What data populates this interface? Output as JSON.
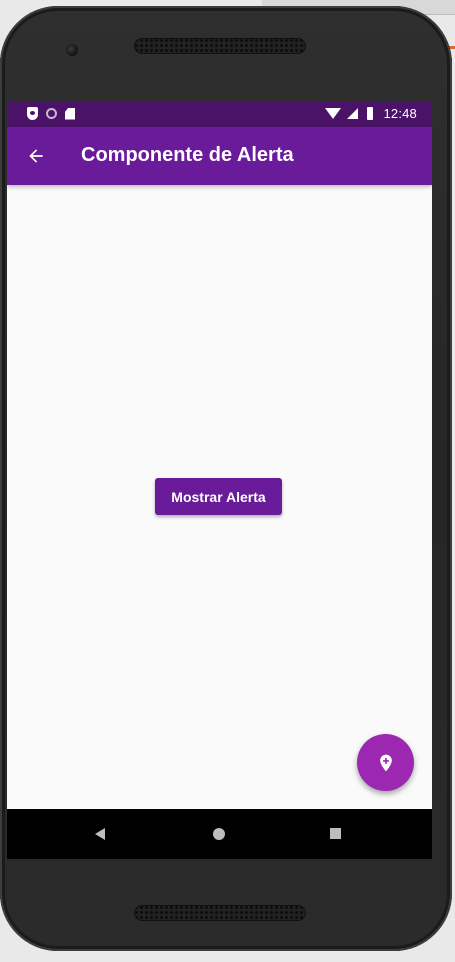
{
  "status_bar": {
    "time": "12:48",
    "left_icons": [
      "shield-icon",
      "circle-icon",
      "sd-card-icon"
    ],
    "right_icons": [
      "wifi-icon",
      "signal-icon",
      "battery-icon"
    ],
    "color": "#4a1367"
  },
  "app_bar": {
    "title": "Componente de Alerta",
    "back_icon": "arrow-left-icon",
    "color": "#6a1b9a"
  },
  "main": {
    "show_alert_label": "Mostrar Alerta",
    "button_color": "#6a1b9a",
    "background": "#fafafa"
  },
  "fab": {
    "icon": "add-location-icon",
    "color": "#9c27b0"
  },
  "nav_bar": {
    "icons": [
      "back-triangle-icon",
      "home-circle-icon",
      "recents-square-icon"
    ]
  }
}
